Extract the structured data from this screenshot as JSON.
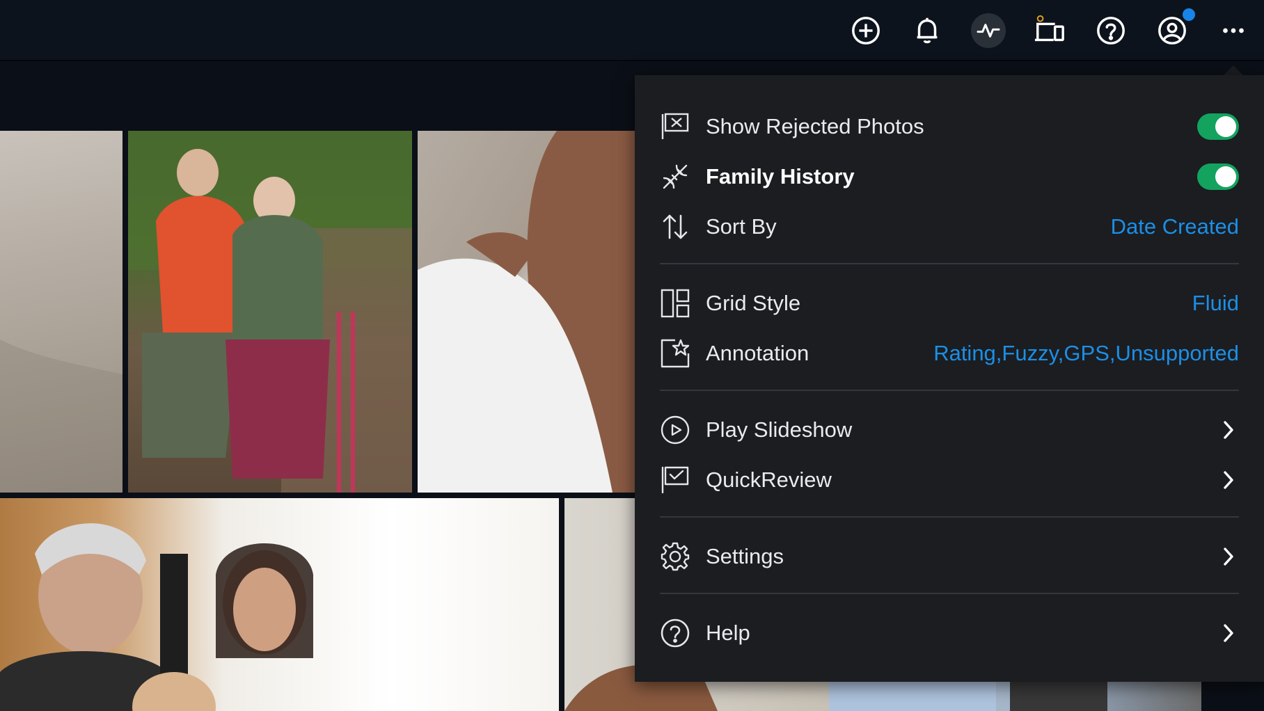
{
  "toolbar": {
    "icons": [
      "add-icon",
      "bell-icon",
      "activity-icon",
      "devices-icon",
      "help-icon",
      "account-icon",
      "more-icon"
    ],
    "accent": "#1785e8"
  },
  "menu": {
    "show_rejected": {
      "label": "Show Rejected Photos",
      "enabled": true
    },
    "family_history": {
      "label": "Family History",
      "enabled": true
    },
    "sort_by": {
      "label": "Sort By",
      "value": "Date Created"
    },
    "grid_style": {
      "label": "Grid Style",
      "value": "Fluid"
    },
    "annotation": {
      "label": "Annotation",
      "value": "Rating,Fuzzy,GPS,Unsupported"
    },
    "play_slideshow": {
      "label": "Play Slideshow"
    },
    "quickreview": {
      "label": "QuickReview"
    },
    "settings": {
      "label": "Settings"
    },
    "help": {
      "label": "Help"
    },
    "colors": {
      "value": "#1c8fe6",
      "toggle_on": "#13a35f",
      "background": "#1b1d21"
    }
  }
}
